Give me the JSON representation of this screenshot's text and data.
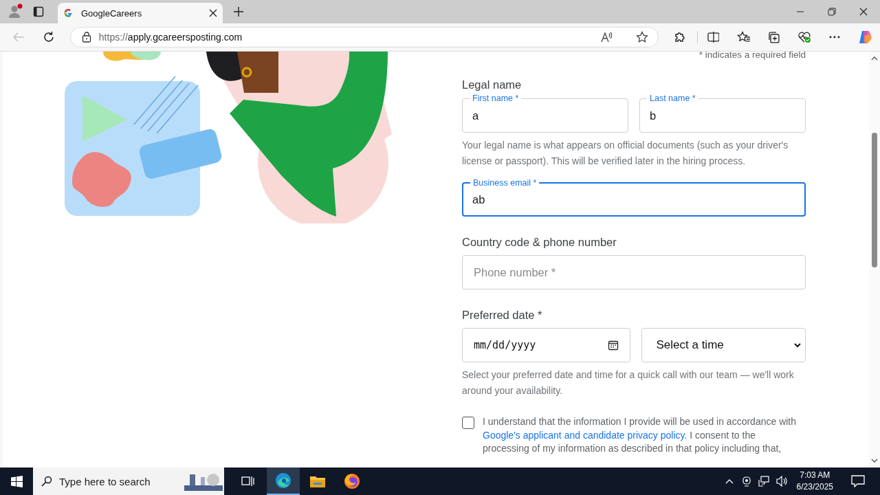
{
  "browser": {
    "tabs": [
      {
        "title": "GoogleCareers",
        "selected": true
      }
    ],
    "url_scheme": "https://",
    "url_host": "apply.gcareersposting.com"
  },
  "form": {
    "required_note": "* indicates a required field",
    "legal_name": {
      "heading": "Legal name",
      "fields": [
        {
          "label": "First name *",
          "value": "a"
        },
        {
          "label": "Last name *",
          "value": "b"
        }
      ],
      "help": "Your legal name is what appears on official documents (such as your driver's license or passport). This will be verified later in the hiring process."
    },
    "email": {
      "label": "Business email *",
      "value": "ab",
      "focused": true
    },
    "phone": {
      "heading": "Country code & phone number",
      "placeholder": "Phone number *"
    },
    "preferred_date": {
      "heading": "Preferred date *",
      "date_placeholder": "mm/dd/yyyy",
      "time_select": "Select a time",
      "help": "Select your preferred date and time for a quick call with our team — we'll work around your availability."
    },
    "consent": {
      "checked": false,
      "text_before": "I understand that the information I provide will be used in accordance with",
      "link": "Google's applicant and candidate privacy policy",
      "text_after": ". I consent to the processing of my information as described in that policy including that,"
    }
  },
  "taskbar": {
    "search_placeholder": "Type here to search",
    "time": "7:03 AM",
    "date": "6/23/2025"
  }
}
